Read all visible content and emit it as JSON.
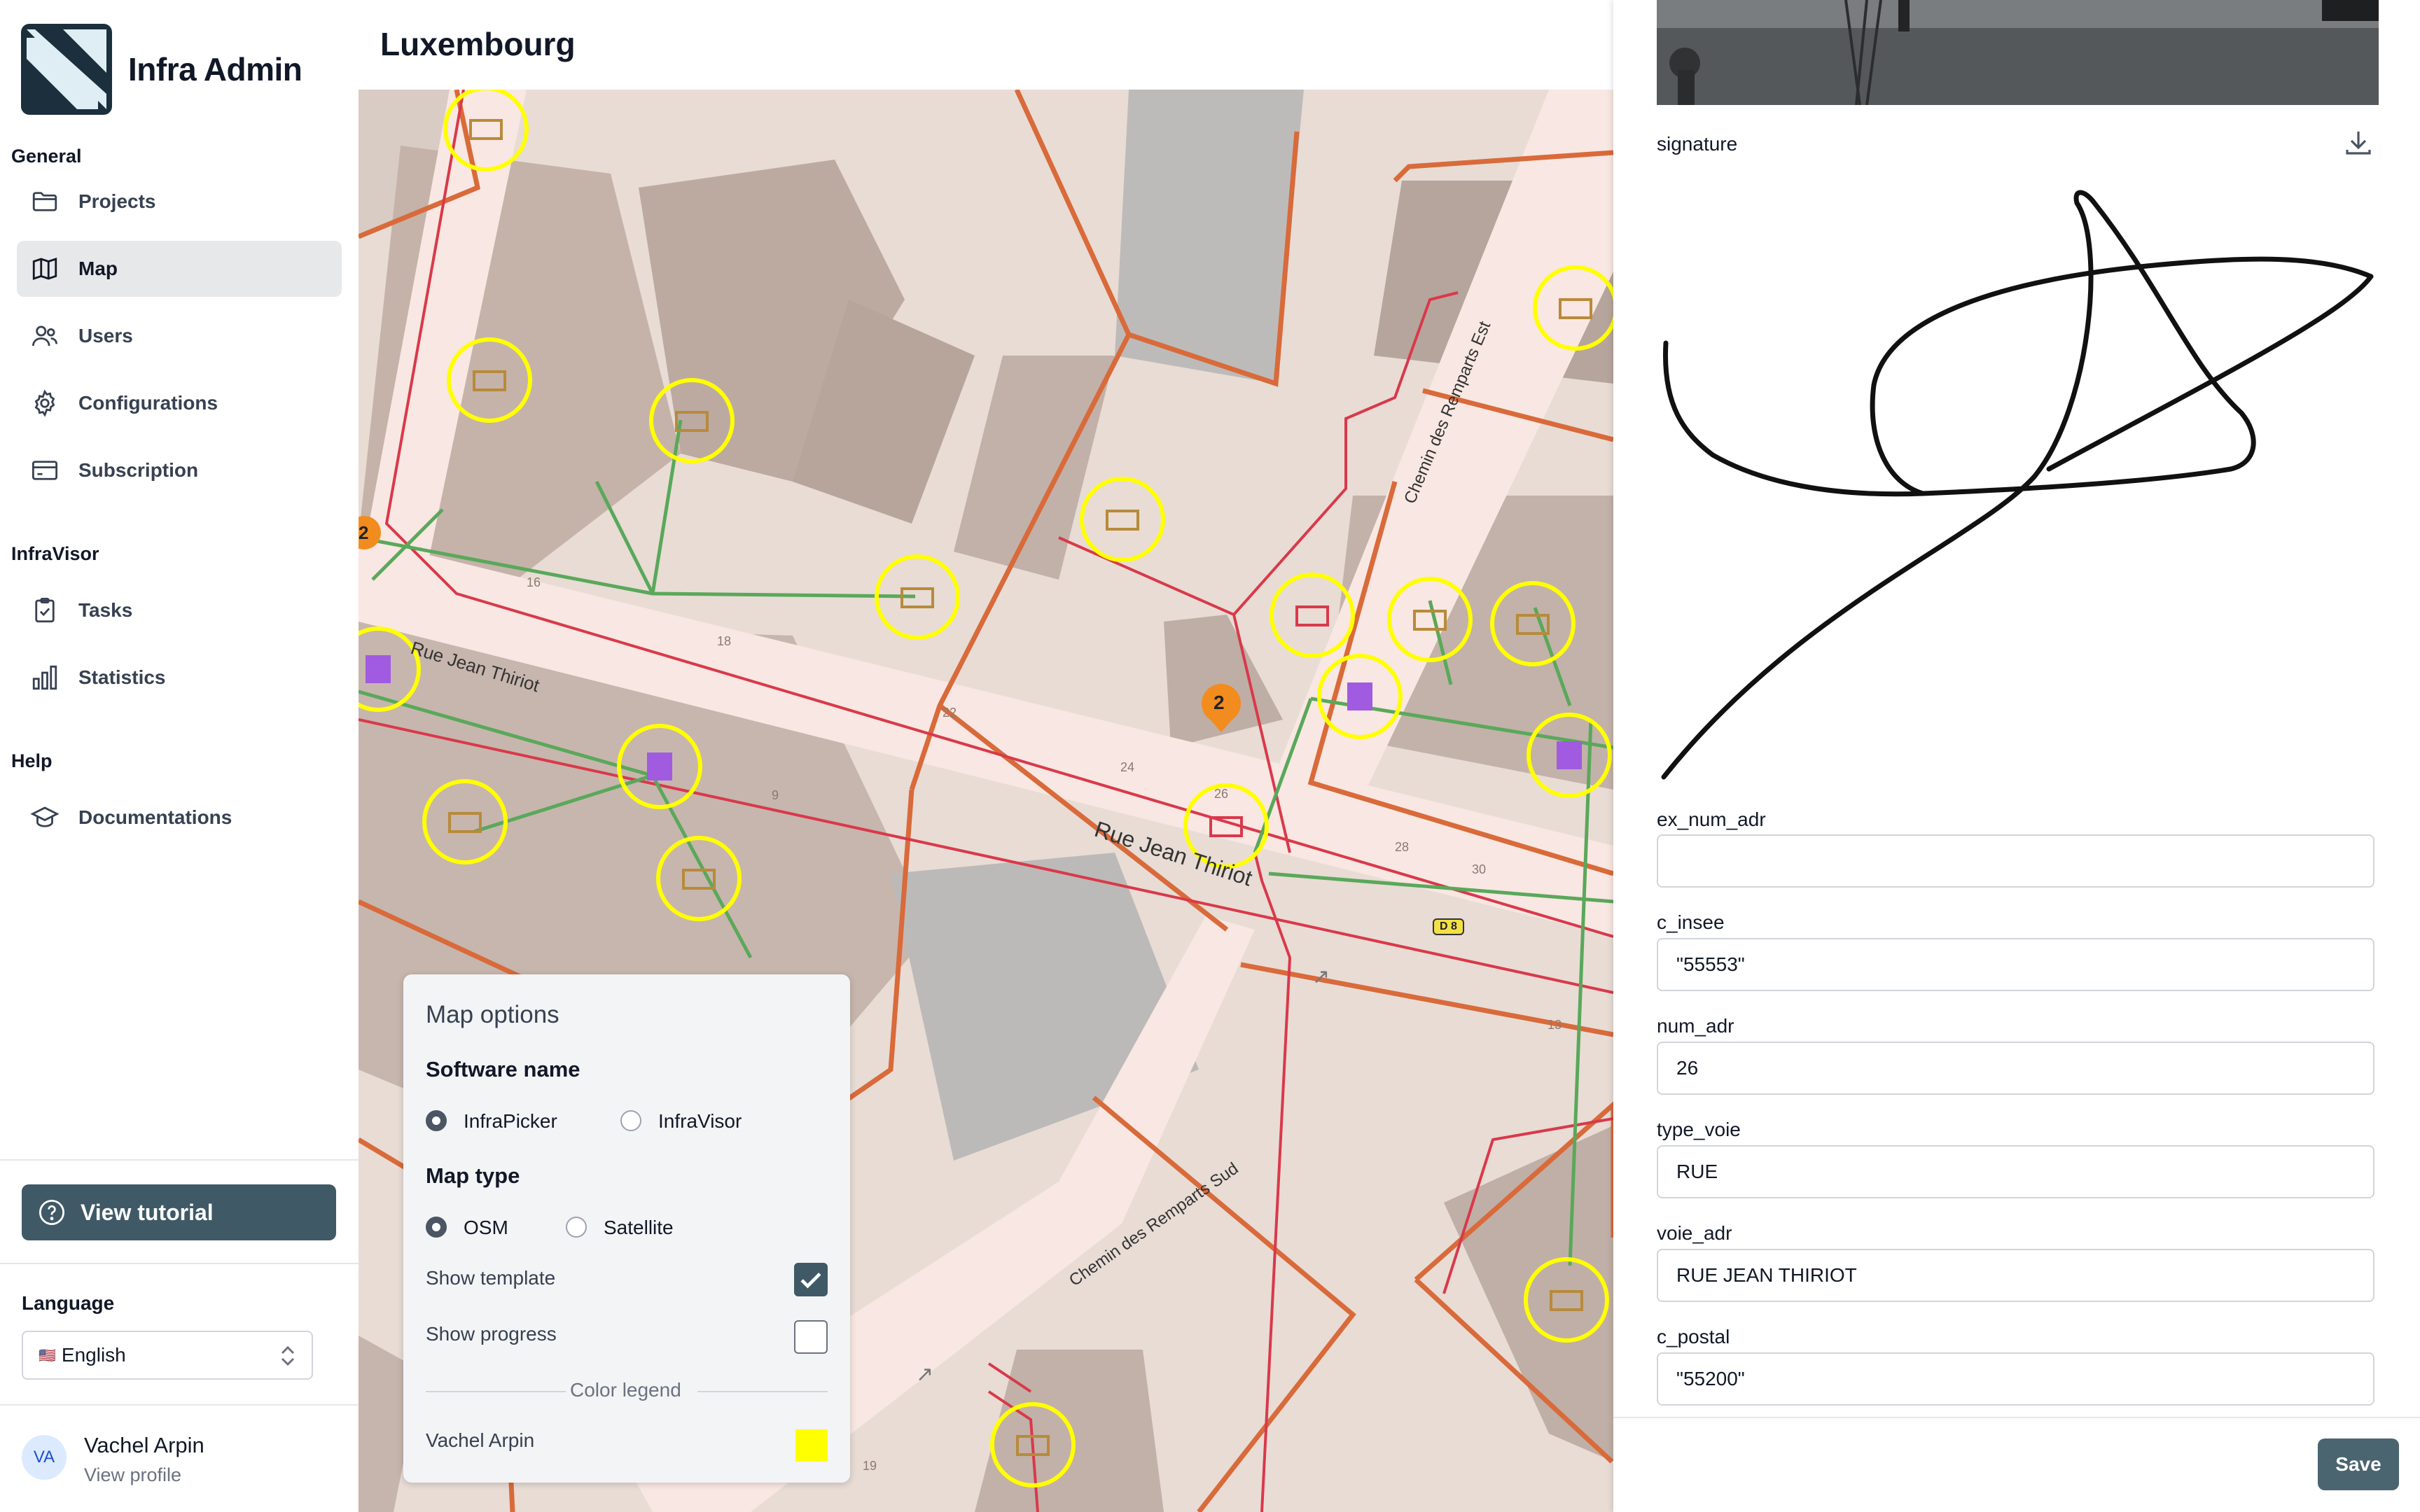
{
  "app": {
    "title": "Infra Admin"
  },
  "sidebar": {
    "sections": {
      "general": "General",
      "infravisor": "InfraVisor",
      "help": "Help"
    },
    "items": [
      {
        "label": "Projects",
        "icon": "folder-icon",
        "active": false
      },
      {
        "label": "Map",
        "icon": "map-icon",
        "active": true
      },
      {
        "label": "Users",
        "icon": "users-icon",
        "active": false
      },
      {
        "label": "Configurations",
        "icon": "gear-icon",
        "active": false
      },
      {
        "label": "Subscription",
        "icon": "credit-card-icon",
        "active": false
      },
      {
        "label": "Tasks",
        "icon": "clipboard-check-icon",
        "active": false
      },
      {
        "label": "Statistics",
        "icon": "bar-chart-icon",
        "active": false
      },
      {
        "label": "Documentations",
        "icon": "graduation-cap-icon",
        "active": false
      }
    ],
    "tutorial_label": "View tutorial",
    "language_label": "Language",
    "language_value": "English",
    "language_flag": "🇺🇸",
    "user": {
      "initials": "VA",
      "name": "Vachel Arpin",
      "link": "View profile"
    }
  },
  "header": {
    "title": "Luxembourg"
  },
  "map": {
    "streets": [
      "Rue Jean Thiriot",
      "Rue Jean Thiriot",
      "Chemin des Remparts Est",
      "Chemin des Remparts Sud"
    ],
    "house_numbers": [
      "16",
      "18",
      "22",
      "24",
      "26",
      "28",
      "30",
      "9",
      "13",
      "19"
    ],
    "route_badge": "D 8",
    "cluster_counts": [
      "2",
      "2"
    ]
  },
  "map_options": {
    "title": "Map options",
    "software_heading": "Software name",
    "software_options": [
      {
        "label": "InfraPicker",
        "selected": true
      },
      {
        "label": "InfraVisor",
        "selected": false
      }
    ],
    "map_type_heading": "Map type",
    "map_type_options": [
      {
        "label": "OSM",
        "selected": true
      },
      {
        "label": "Satellite",
        "selected": false
      }
    ],
    "show_template_label": "Show template",
    "show_template": true,
    "show_progress_label": "Show progress",
    "show_progress": false,
    "legend_title": "Color legend",
    "legend": [
      {
        "name": "Vachel Arpin",
        "color": "#ffff00"
      }
    ]
  },
  "detail": {
    "signature_label": "signature",
    "fields": [
      {
        "label": "ex_num_adr",
        "value": ""
      },
      {
        "label": "c_insee",
        "value": "\"55553\""
      },
      {
        "label": "num_adr",
        "value": "26"
      },
      {
        "label": "type_voie",
        "value": "RUE"
      },
      {
        "label": "voie_adr",
        "value": "RUE JEAN THIRIOT"
      },
      {
        "label": "c_postal",
        "value": "\"55200\""
      }
    ],
    "save_label": "Save"
  },
  "colors": {
    "accent": "#3f5a66",
    "marker_ring": "#ffff00",
    "cable_red": "#d9394a",
    "cable_green": "#5aa85a",
    "parcel_orange": "#d96a3a",
    "cluster_orange": "#f28c1f",
    "building_marker": "#a05be0"
  }
}
